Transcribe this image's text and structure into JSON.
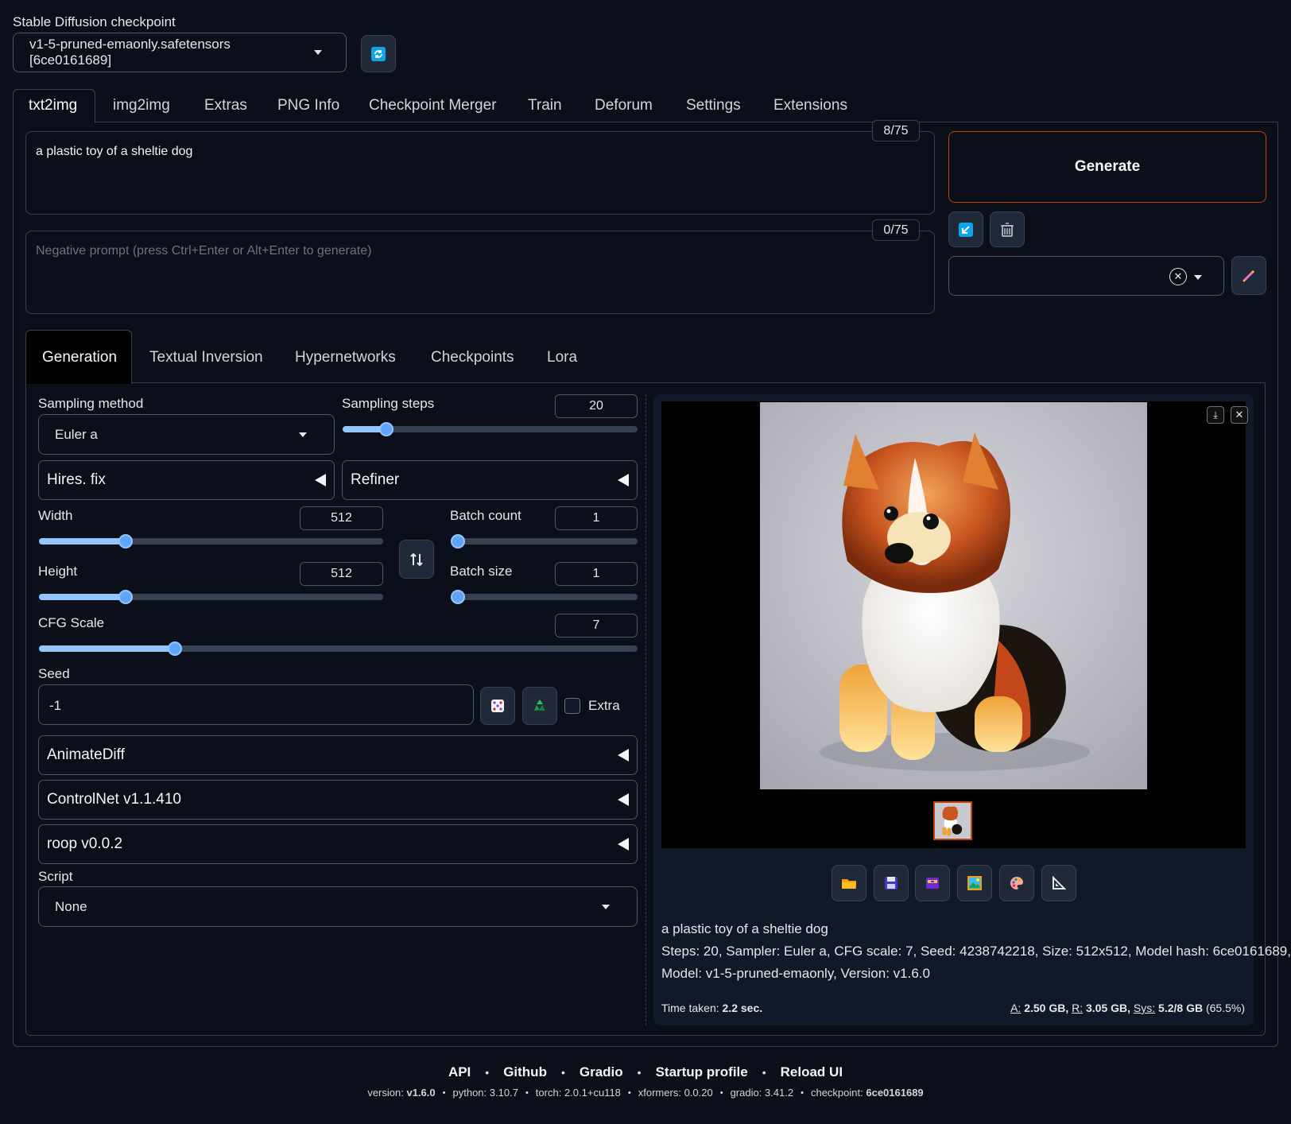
{
  "checkpoint": {
    "label": "Stable Diffusion checkpoint",
    "value": "v1-5-pruned-emaonly.safetensors [6ce0161689]"
  },
  "main_tabs": [
    {
      "label": "txt2img"
    },
    {
      "label": "img2img"
    },
    {
      "label": "Extras"
    },
    {
      "label": "PNG Info"
    },
    {
      "label": "Checkpoint Merger"
    },
    {
      "label": "Train"
    },
    {
      "label": "Deforum"
    },
    {
      "label": "Settings"
    },
    {
      "label": "Extensions"
    }
  ],
  "prompt": {
    "value": "a plastic toy of a sheltie dog",
    "counter": "8/75"
  },
  "negative_prompt": {
    "placeholder": "Negative prompt (press Ctrl+Enter or Alt+Enter to generate)",
    "counter": "0/75"
  },
  "generate_label": "Generate",
  "sub_tabs": [
    {
      "label": "Generation"
    },
    {
      "label": "Textual Inversion"
    },
    {
      "label": "Hypernetworks"
    },
    {
      "label": "Checkpoints"
    },
    {
      "label": "Lora"
    }
  ],
  "sampling": {
    "method_label": "Sampling method",
    "method_value": "Euler a",
    "steps_label": "Sampling steps",
    "steps_value": "20"
  },
  "hires_label": "Hires. fix",
  "refiner_label": "Refiner",
  "width": {
    "label": "Width",
    "value": "512"
  },
  "height": {
    "label": "Height",
    "value": "512"
  },
  "batch_count": {
    "label": "Batch count",
    "value": "1"
  },
  "batch_size": {
    "label": "Batch size",
    "value": "1"
  },
  "cfg": {
    "label": "CFG Scale",
    "value": "7"
  },
  "seed": {
    "label": "Seed",
    "value": "-1",
    "extra_label": "Extra"
  },
  "accordions": [
    {
      "label": "AnimateDiff"
    },
    {
      "label": "ControlNet v1.1.410"
    },
    {
      "label": "roop v0.0.2"
    }
  ],
  "script": {
    "label": "Script",
    "value": "None"
  },
  "output": {
    "prompt_line": "a plastic toy of a sheltie dog",
    "params_line1": "Steps: 20, Sampler: Euler a, CFG scale: 7, Seed: 4238742218, Size: 512x512, Model hash: 6ce0161689,",
    "params_line2": "Model: v1-5-pruned-emaonly, Version: v1.6.0",
    "time_label": "Time taken:",
    "time_value": "2.2 sec.",
    "mem_a_label": "A:",
    "mem_a_value": "2.50 GB,",
    "mem_r_label": "R:",
    "mem_r_value": "3.05 GB,",
    "mem_sys_label": "Sys:",
    "mem_sys_value": "5.2/8 GB",
    "mem_pct": "(65.5%)"
  },
  "footer": {
    "links": [
      "API",
      "Github",
      "Gradio",
      "Startup profile",
      "Reload UI"
    ],
    "versions": [
      {
        "label": "version:",
        "value": "v1.6.0"
      },
      {
        "label": "python:",
        "value": "3.10.7"
      },
      {
        "label": "torch:",
        "value": "2.0.1+cu118"
      },
      {
        "label": "xformers:",
        "value": "0.0.20"
      },
      {
        "label": "gradio:",
        "value": "3.41.2"
      },
      {
        "label": "checkpoint:",
        "value": "6ce0161689"
      }
    ]
  },
  "sliders": {
    "steps": 0.13,
    "width": 0.24,
    "height": 0.24,
    "batch_count": 0.0,
    "batch_size": 0.0,
    "cfg": 0.22
  },
  "colors": {
    "background": "#0b0f19",
    "accent": "#60a5fa",
    "generate_border": "#c2410c"
  }
}
